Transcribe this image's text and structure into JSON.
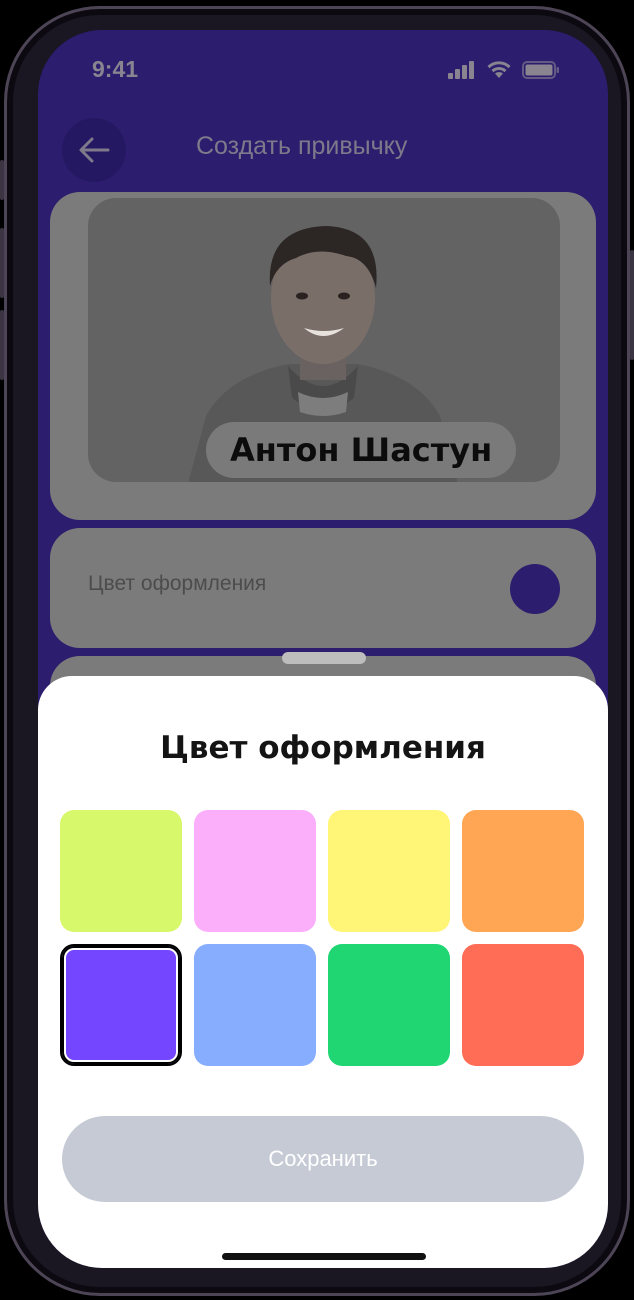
{
  "status_bar": {
    "time": "9:41",
    "icons": [
      "signal-icon",
      "wifi-icon",
      "battery-icon"
    ]
  },
  "header": {
    "title": "Создать привычку",
    "back_icon": "arrow-left-icon"
  },
  "profile_card": {
    "name": "Антон Шастун"
  },
  "color_setting": {
    "label": "Цвет оформления",
    "current_color": "#2c1d6e"
  },
  "sheet": {
    "title": "Цвет оформления",
    "swatches": [
      {
        "color": "#d6f86a",
        "selected": false
      },
      {
        "color": "#fbaffb",
        "selected": false
      },
      {
        "color": "#fff576",
        "selected": false
      },
      {
        "color": "#ffa654",
        "selected": false
      },
      {
        "color": "#7446ff",
        "selected": true
      },
      {
        "color": "#87adff",
        "selected": false
      },
      {
        "color": "#1fd673",
        "selected": false
      },
      {
        "color": "#ff6d56",
        "selected": false
      }
    ],
    "save_label": "Сохранить"
  }
}
